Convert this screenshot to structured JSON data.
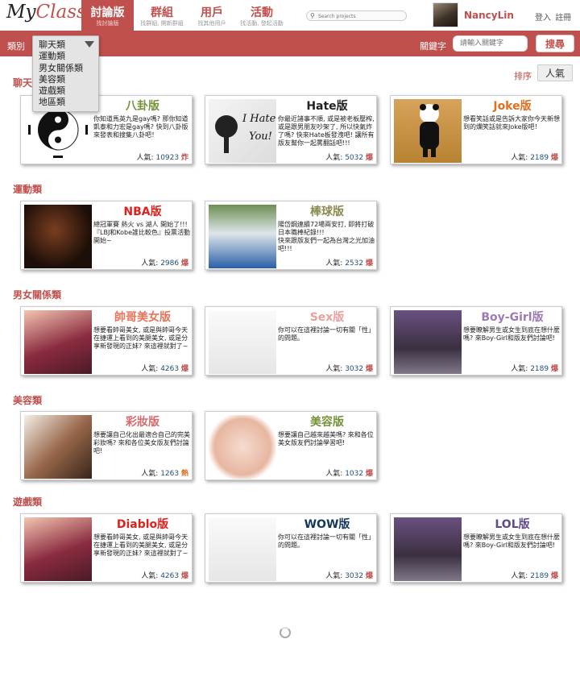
{
  "app": {
    "logo_prefix": "My",
    "logo_suffix": "Class"
  },
  "nav": [
    {
      "label": "討論版",
      "sub": "找討論版"
    },
    {
      "label": "群組",
      "sub": "找群組, 開新群組"
    },
    {
      "label": "用戶",
      "sub": "找其他用戶"
    },
    {
      "label": "活動",
      "sub": "找活動, 發起活動"
    }
  ],
  "search": {
    "placeholder": "Search projects"
  },
  "user": {
    "name": "NancyLin"
  },
  "auth": {
    "login": "登入",
    "register": "註冊"
  },
  "filter": {
    "category_label": "類別",
    "options": [
      "聊天類",
      "運動類",
      "男女關係類",
      "美容類",
      "遊戲類",
      "地區類"
    ],
    "keyword_label": "關鍵字",
    "keyword_placeholder": "請輸入關鍵字",
    "search_button": "搜尋"
  },
  "sort": {
    "label": "排序",
    "value": "人氣"
  },
  "popularity_label": "人氣:",
  "sections": [
    {
      "title": "聊天類",
      "cards": [
        {
          "title": "八卦版",
          "desc": "你知道馬英九是gay嗎? 那你知道凱泰和力宏是gay嗎? 快到八卦版來發表和搜集八卦吧！",
          "count": "10923",
          "badge": "炸",
          "image": "yin-yang-icon",
          "title_color": "#76923c"
        },
        {
          "title": "Hate版",
          "desc": "你最近諸事不順, 或是被老板壓榨, 或是跟男朋友吵架了, 所以快氣炸了嗎? 快來Hate板發洩吧! 讓所有版友幫你一起罵翻話吧!!!",
          "count": "5032",
          "badge": "爆",
          "image": "i-hate-you-image",
          "title_color": "#222222"
        },
        {
          "title": "Joke版",
          "desc": "想看笑話或是告訴大家你今天新想到的爛笑話就來Joke版吧！",
          "count": "2189",
          "badge": "爆",
          "image": "panda-image",
          "title_color": "#e07020"
        }
      ]
    },
    {
      "title": "運動類",
      "cards": [
        {
          "title": "NBA版",
          "desc": "總冠軍賽 熱火 vs 湖人 開始了!!!\n『LBJ和Kobe誰比較色』投票活動開始~",
          "count": "2986",
          "badge": "爆",
          "image": "basketball-player-image",
          "title_color": "#e0201d"
        },
        {
          "title": "棒球版",
          "desc": "陽岱鋼連續72場兩安打, 即將打破日本職棒紀錄!!!\n快來跟版友們一起為台灣之光加油吧!!!",
          "count": "2532",
          "badge": "爆",
          "image": "baseball-player-image",
          "title_color": "#8a8a50"
        }
      ]
    },
    {
      "title": "男女關係類",
      "cards": [
        {
          "title": "帥哥美女版",
          "desc": "想要看帥哥美女, 或是與帥哥今天在捷運上看到的美腿美女, 或是分享新發現的正妹? 來這裡就對了~",
          "count": "4263",
          "badge": "爆",
          "image": "girl-portrait-image",
          "title_color": "#e8745a"
        },
        {
          "title": "Sex版",
          "desc": "你可以在這裡討論一切有關「性」的問題。",
          "count": "3032",
          "badge": "爆",
          "image": "couple-sketch-image",
          "title_color": "#e8a0a0"
        },
        {
          "title": "Boy-Girl版",
          "desc": "想要瞭解男生或女生到底在想什麼嗎? 來Boy-Girl和版友們討論吧!",
          "count": "2189",
          "badge": "爆",
          "image": "holding-hands-image",
          "title_color": "#9d7ab4"
        }
      ]
    },
    {
      "title": "美容類",
      "cards": [
        {
          "title": "彩妝版",
          "desc": "想要讓自己化出最適合自己的完美彩妝嗎? 來和各位美女版友們討論吧!",
          "count": "1263",
          "badge": "熱",
          "image": "makeup-image",
          "title_color": "#d46a6a"
        },
        {
          "title": "美容版",
          "desc": "想要讓自己越來越美嗎? 來和各位美女版友們討論學習吧!",
          "count": "1032",
          "badge": "爆",
          "image": "beauty-face-image",
          "title_color": "#76923c"
        }
      ]
    },
    {
      "title": "遊戲類",
      "cards": [
        {
          "title": "Diablo版",
          "desc": "想要看帥哥美女, 或是與帥哥今天在捷運上看到的美腿美女, 或是分享新發現的正妹? 來這裡就對了~",
          "count": "4263",
          "badge": "爆",
          "image": "girl-portrait-image",
          "title_color": "#e0201d"
        },
        {
          "title": "WOW版",
          "desc": "你可以在這裡討論一切有關「性」的問題。",
          "count": "3032",
          "badge": "爆",
          "image": "couple-sketch-image",
          "title_color": "#17365d"
        },
        {
          "title": "LOL版",
          "desc": "想要瞭解男生或女生到底在想什麼嗎? 來Boy-Girl和版友們討論吧!",
          "count": "2189",
          "badge": "爆",
          "image": "holding-hands-image",
          "title_color": "#5f4a8b"
        }
      ]
    }
  ]
}
